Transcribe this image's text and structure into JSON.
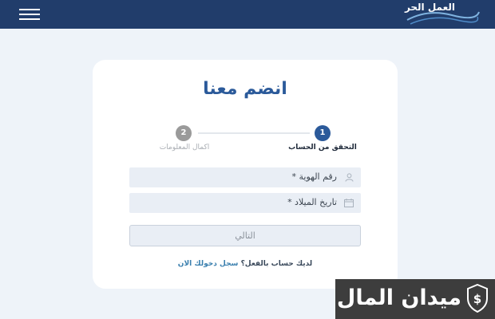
{
  "header": {
    "logo_text": "العمل الحر",
    "menu_icon": "hamburger-menu-icon"
  },
  "form": {
    "title": "انضم معنا",
    "steps": [
      {
        "number": "1",
        "label": "التحقق من الحساب",
        "state": "active"
      },
      {
        "number": "2",
        "label": "اكمال المعلومات",
        "state": "inactive"
      }
    ],
    "fields": {
      "id_number_placeholder": "رقم الهوية *",
      "id_icon": "user-icon",
      "dob_placeholder": "تاريخ الميلاد *",
      "dob_icon": "calendar-icon"
    },
    "next_button": "التالي",
    "login_prompt": "لديك حساب بالفعل؟",
    "login_link": "سجل دخولك الان"
  },
  "watermark": {
    "text": "ميدان المال",
    "icon": "shield-dollar-icon"
  },
  "colors": {
    "header_bg": "#213d6b",
    "page_bg": "#eef3f9",
    "accent": "#2b5a9a",
    "link": "#3a7fae",
    "field_bg": "#e9eef5"
  }
}
